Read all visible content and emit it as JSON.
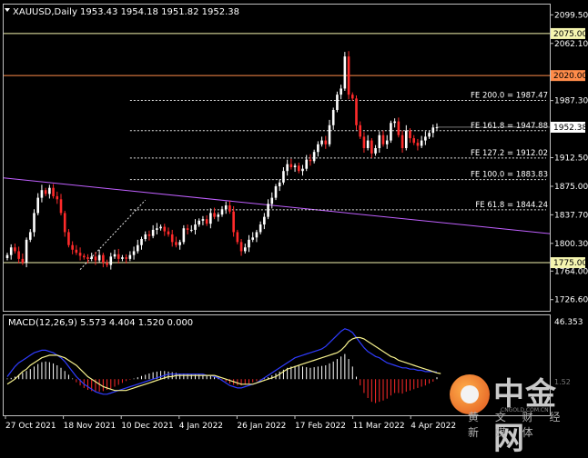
{
  "window": {
    "symbol_header": "XAUUSD,Daily  1953.43 1954.18 1951.82 1952.38"
  },
  "indicator_header": "MACD(12,26,9) 5.573 4.404 1.520 0.000",
  "watermark": {
    "brand_cn": "中金网",
    "url": "CNGOLD.COM.CN",
    "slogan": "黄 文 财 经 新 媒 体"
  },
  "colors": {
    "background": "#000000",
    "candle_up": "#ffffff",
    "candle_down": "#ff2a2a",
    "level_line": "#f5f5b0",
    "resistance_line": "#ff8c4a",
    "trend_line": "#c060ff",
    "macd_hist_up": "#ffffff",
    "macd_hist_down": "#ff2a2a",
    "macd_line": "#2f3cff",
    "signal_line": "#f5f08c"
  },
  "chart_data": [
    {
      "type": "candlestick",
      "symbol": "XAUUSD",
      "timeframe": "Daily",
      "ohlc_last": {
        "open": 1953.43,
        "high": 1954.18,
        "low": 1951.82,
        "close": 1952.38
      },
      "x_tick_labels": [
        "27 Oct 2021",
        "18 Nov 2021",
        "10 Dec 2021",
        "4 Jan 2022",
        "26 Jan 2022",
        "17 Feb 2022",
        "11 Mar 2022",
        "4 Apr 2022"
      ],
      "y_tick_labels": [
        "2099.50",
        "2062.10",
        "1987.30",
        "1912.50",
        "1875.00",
        "1837.70",
        "1800.30",
        "1764.00",
        "1726.60"
      ],
      "y_range": [
        1712,
        2113
      ],
      "close_series": [
        1785,
        1795,
        1790,
        1780,
        1775,
        1805,
        1815,
        1840,
        1860,
        1870,
        1865,
        1873,
        1862,
        1858,
        1840,
        1815,
        1798,
        1792,
        1788,
        1784,
        1782,
        1780,
        1783,
        1778,
        1785,
        1775,
        1772,
        1783,
        1786,
        1780,
        1782,
        1780,
        1785,
        1790,
        1798,
        1806,
        1812,
        1810,
        1818,
        1820,
        1822,
        1816,
        1812,
        1802,
        1798,
        1802,
        1820,
        1818,
        1818,
        1825,
        1830,
        1832,
        1826,
        1840,
        1835,
        1838,
        1845,
        1850,
        1842,
        1815,
        1802,
        1790,
        1795,
        1805,
        1808,
        1815,
        1825,
        1835,
        1852,
        1860,
        1875,
        1880,
        1895,
        1904,
        1900,
        1902,
        1895,
        1898,
        1910,
        1908,
        1920,
        1930,
        1935,
        1930,
        1955,
        1975,
        1995,
        2003,
        2045,
        1995,
        1990,
        1955,
        1940,
        1925,
        1935,
        1918,
        1925,
        1942,
        1930,
        1935,
        1958,
        1960,
        1942,
        1925,
        1948,
        1938,
        1932,
        1928,
        1935,
        1940,
        1945,
        1952,
        1952.38
      ],
      "horizontal_lines": [
        {
          "value": 2075.0,
          "label": "2075.00",
          "color": "#f5f5b0"
        },
        {
          "value": 2020.0,
          "label": "2020.00",
          "color": "#ff8c4a"
        },
        {
          "value": 1775.0,
          "label": "1775.00",
          "color": "#f5f5b0"
        }
      ],
      "fibonacci_expansion": [
        {
          "label": "FE 200.0 = 1987.47",
          "value": 1987.47
        },
        {
          "label": "FE 161.8 = 1947.88",
          "value": 1947.88
        },
        {
          "label": "FE 127.2 = 1912.02",
          "value": 1912.02
        },
        {
          "label": "FE 100.0 = 1883.83",
          "value": 1883.83
        },
        {
          "label": "FE 61.8 = 1844.24",
          "value": 1844.24
        }
      ],
      "current_price": {
        "value": 1952.38,
        "label": "1952.38"
      },
      "trendline": {
        "from": 1886,
        "to": 1813
      }
    },
    {
      "type": "macd",
      "params": "MACD(12,26,9)",
      "values": {
        "macd": 5.573,
        "signal": 4.404,
        "histogram": 1.52,
        "zero": 0.0
      },
      "y_tick_labels": [
        "46.353"
      ],
      "y_range": [
        -28,
        50
      ],
      "histogram": [
        0.5,
        1.0,
        2.0,
        3.5,
        5.0,
        6.5,
        8.0,
        10.0,
        12.0,
        13.5,
        14.0,
        13.5,
        12.5,
        11.0,
        9.0,
        6.5,
        3.5,
        0.5,
        -2.5,
        -5.0,
        -7.0,
        -8.5,
        -9.5,
        -10.0,
        -10.0,
        -9.5,
        -8.5,
        -7.5,
        -6.0,
        -4.5,
        -3.0,
        -1.5,
        -0.5,
        0.5,
        1.5,
        2.5,
        3.5,
        4.5,
        5.5,
        6.0,
        6.5,
        6.5,
        6.0,
        5.5,
        5.0,
        4.5,
        4.5,
        4.5,
        4.0,
        4.0,
        4.0,
        3.5,
        3.0,
        2.5,
        2.0,
        1.0,
        -0.5,
        -2.0,
        -3.5,
        -4.5,
        -5.0,
        -5.0,
        -4.5,
        -3.5,
        -2.5,
        -1.5,
        -0.5,
        0.5,
        1.5,
        3.0,
        4.5,
        6.0,
        7.5,
        9.0,
        10.0,
        10.5,
        10.5,
        10.0,
        9.5,
        9.0,
        9.5,
        10.0,
        10.5,
        11.0,
        12.5,
        14.0,
        16.0,
        18.0,
        20.0,
        16.0,
        10.0,
        2.0,
        -5.0,
        -11.0,
        -15.0,
        -18.0,
        -19.0,
        -18.0,
        -17.0,
        -15.5,
        -13.0,
        -11.0,
        -11.0,
        -11.5,
        -10.0,
        -9.0,
        -8.0,
        -7.0,
        -6.0,
        -5.0,
        -3.5,
        -2.0,
        1.52
      ],
      "macd_line": [
        2,
        6,
        10,
        13,
        15,
        17,
        19,
        21,
        22,
        23,
        23,
        22,
        21,
        19,
        17,
        14,
        10,
        6,
        2,
        -1,
        -4,
        -6,
        -8,
        -10,
        -11,
        -12,
        -12,
        -11,
        -10,
        -9,
        -8,
        -7,
        -6,
        -5,
        -4,
        -3,
        -2,
        -1,
        0,
        1,
        2,
        3,
        4,
        4,
        4,
        4,
        4,
        4,
        4,
        4,
        4,
        4,
        3,
        3,
        2,
        1,
        -1,
        -3,
        -5,
        -6,
        -7,
        -7,
        -6,
        -5,
        -4,
        -3,
        -1,
        1,
        3,
        5,
        7,
        9,
        11,
        13,
        15,
        17,
        18,
        19,
        20,
        21,
        22,
        23,
        24,
        26,
        29,
        32,
        35,
        38,
        40,
        39,
        37,
        33,
        29,
        25,
        22,
        20,
        18,
        17,
        15,
        13,
        12,
        11,
        10,
        9,
        9,
        8,
        8,
        7,
        7,
        6,
        6,
        6,
        5.573
      ],
      "signal_line": [
        -4,
        -2,
        0,
        3,
        6,
        8,
        11,
        13,
        15,
        17,
        18,
        19,
        19,
        19,
        18,
        17,
        15,
        13,
        11,
        8,
        5,
        2,
        0,
        -2,
        -4,
        -6,
        -7,
        -8,
        -9,
        -9,
        -9,
        -9,
        -8,
        -7,
        -6,
        -5,
        -4,
        -3,
        -2,
        -1,
        0,
        1,
        2,
        2,
        3,
        3,
        3,
        3,
        3,
        3,
        3,
        3,
        3,
        3,
        3,
        2,
        1,
        0,
        -1,
        -2,
        -3,
        -4,
        -4,
        -4,
        -4,
        -3,
        -2,
        -1,
        0,
        1,
        2,
        4,
        6,
        8,
        9,
        10,
        11,
        12,
        13,
        14,
        15,
        16,
        17,
        18,
        19,
        20,
        21,
        23,
        26,
        30,
        32,
        33,
        33,
        32,
        30,
        28,
        26,
        24,
        22,
        20,
        18,
        17,
        15,
        14,
        13,
        12,
        11,
        10,
        9,
        8,
        7,
        6,
        5,
        4.404
      ],
      "x_tick_labels": [
        "27 Oct 2021",
        "18 Nov 2021",
        "10 Dec 2021",
        "4 Jan 2022",
        "26 Jan 2022",
        "17 Feb 2022",
        "11 Mar 2022",
        "4 Apr 2022"
      ]
    }
  ]
}
